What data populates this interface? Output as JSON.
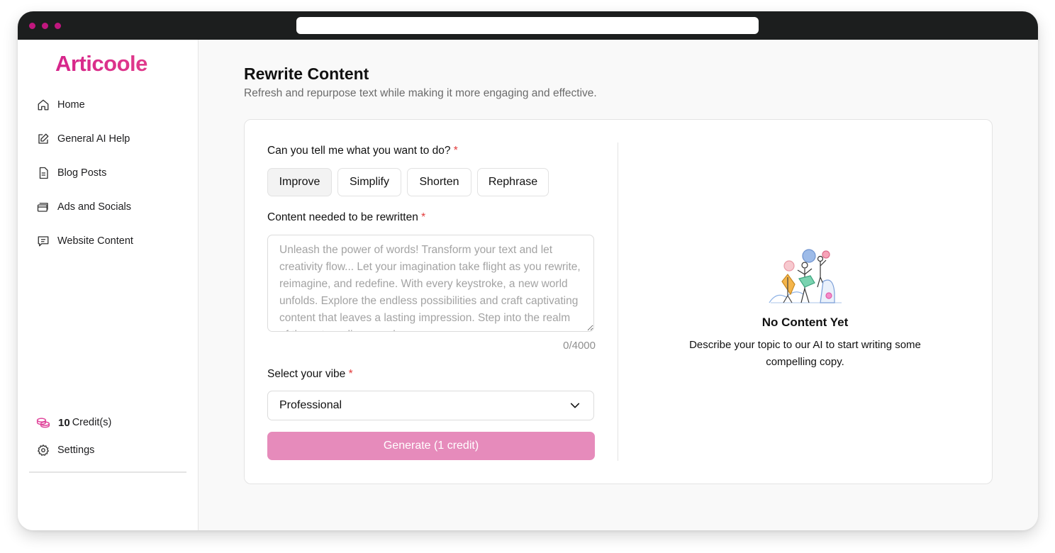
{
  "brand": {
    "logo_text": "Articoole",
    "accent": "#d92a8e",
    "titlebar_dot": "#c0177e"
  },
  "sidebar": {
    "items": [
      {
        "label": "Home",
        "icon": "home-icon"
      },
      {
        "label": "General AI Help",
        "icon": "edit-icon"
      },
      {
        "label": "Blog Posts",
        "icon": "document-icon"
      },
      {
        "label": "Ads and Socials",
        "icon": "cards-icon"
      },
      {
        "label": "Website Content",
        "icon": "message-icon"
      }
    ],
    "credits_count": "10",
    "credits_label": "Credit(s)",
    "settings_label": "Settings"
  },
  "page": {
    "title": "Rewrite Content",
    "subtitle": "Refresh and repurpose text while making it more engaging and effective."
  },
  "form": {
    "action_label": "Can you tell me what you want to do?",
    "required_mark": "*",
    "actions": [
      "Improve",
      "Simplify",
      "Shorten",
      "Rephrase"
    ],
    "selected_action": "Improve",
    "content_label": "Content needed to be rewritten",
    "content_placeholder": "Unleash the power of words! Transform your text and let creativity flow... Let your imagination take flight as you rewrite, reimagine, and redefine. With every keystroke, a new world unfolds. Explore the endless possibilities and craft captivating content that leaves a lasting impression. Step into the realm of the extraordinary and",
    "content_value": "",
    "char_counter": "0/4000",
    "vibe_label": "Select your vibe",
    "vibe_value": "Professional",
    "generate_label": "Generate (1 credit)"
  },
  "empty_state": {
    "title": "No Content Yet",
    "description": "Describe your topic to our AI to start writing some compelling copy."
  }
}
